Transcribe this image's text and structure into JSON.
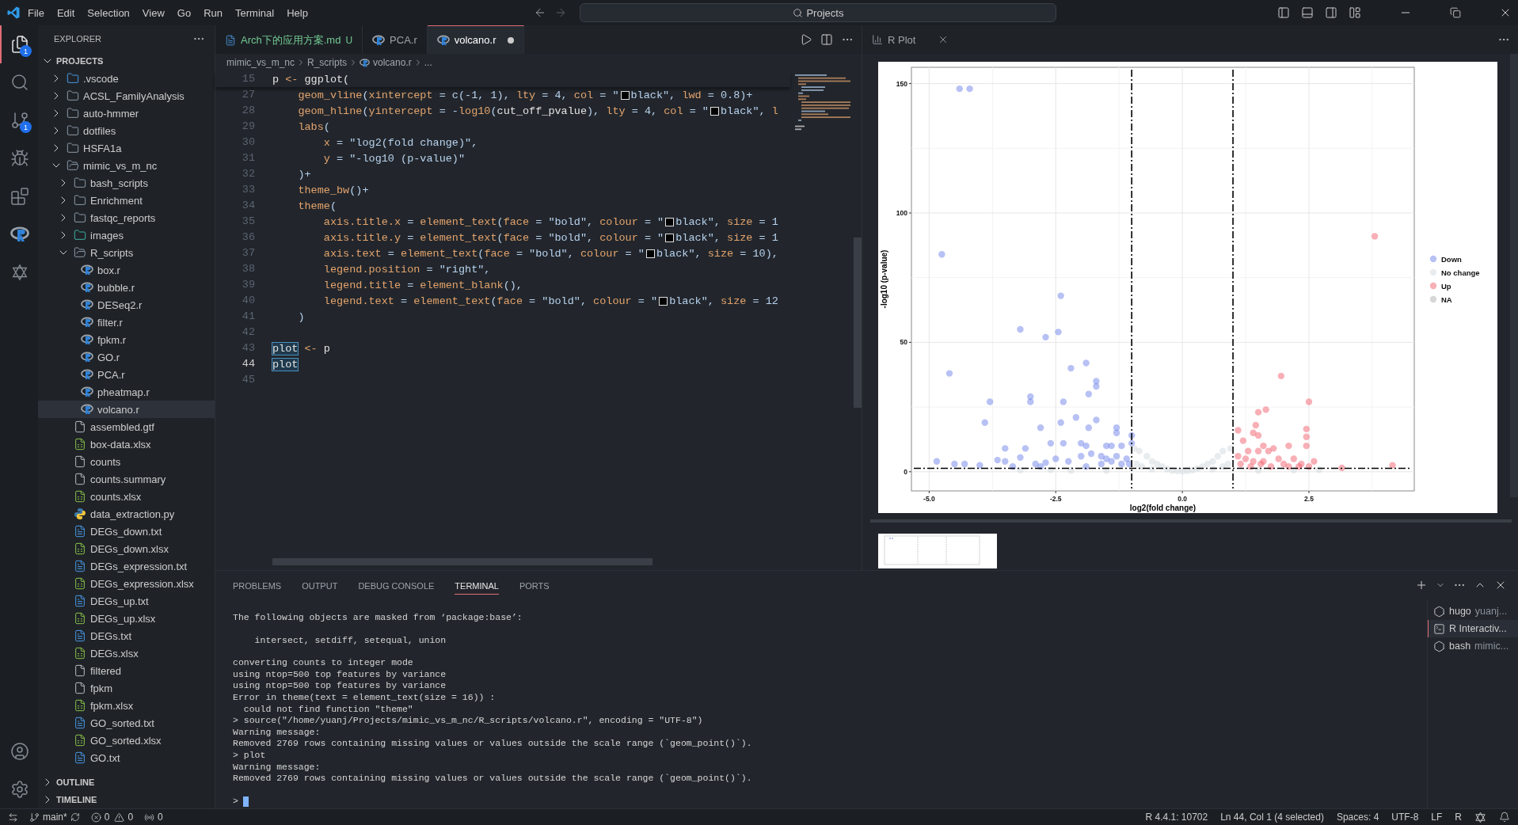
{
  "menu": [
    "File",
    "Edit",
    "Selection",
    "View",
    "Go",
    "Run",
    "Terminal",
    "Help"
  ],
  "command_center": {
    "text": "Projects"
  },
  "activity_bar": {
    "items": [
      {
        "kind": "explorer",
        "badge": "1",
        "selected": true
      },
      {
        "kind": "search",
        "selected": false
      },
      {
        "kind": "source-control",
        "badge": "1",
        "selected": false
      },
      {
        "kind": "run",
        "selected": false
      },
      {
        "kind": "extensions",
        "selected": false
      },
      {
        "kind": "r",
        "selected": false
      },
      {
        "kind": "star",
        "selected": false
      }
    ]
  },
  "sidebar": {
    "title": "EXPLORER",
    "sections": [
      {
        "title": "PROJECTS",
        "expanded": true,
        "items": [
          {
            "label": ".vscode",
            "kind": "vscode-folder",
            "expanded": false,
            "selected": false
          },
          {
            "label": "ACSL_FamilyAnalysis",
            "kind": "folder",
            "expanded": false,
            "selected": false
          },
          {
            "label": "auto-hmmer",
            "kind": "folder",
            "expanded": false,
            "selected": false
          },
          {
            "label": "dotfiles",
            "kind": "folder",
            "expanded": false,
            "selected": false
          },
          {
            "label": "HSFA1a",
            "kind": "folder",
            "expanded": false,
            "selected": false
          },
          {
            "label": "mimic_vs_m_nc",
            "kind": "folder",
            "expanded": true,
            "selected": false,
            "children": [
              {
                "label": "bash_scripts",
                "kind": "folder",
                "expanded": false,
                "selected": false
              },
              {
                "label": "Enrichment",
                "kind": "folder",
                "expanded": false,
                "selected": false
              },
              {
                "label": "fastqc_reports",
                "kind": "folder",
                "expanded": false,
                "selected": false
              },
              {
                "label": "images",
                "kind": "images-folder",
                "expanded": false,
                "selected": false
              },
              {
                "label": "R_scripts",
                "kind": "folder",
                "expanded": true,
                "selected": false,
                "children": [
                  {
                    "label": "box.r",
                    "kind": "r",
                    "selected": false
                  },
                  {
                    "label": "bubble.r",
                    "kind": "r",
                    "selected": false
                  },
                  {
                    "label": "DESeq2.r",
                    "kind": "r",
                    "selected": false
                  },
                  {
                    "label": "filter.r",
                    "kind": "r",
                    "selected": false
                  },
                  {
                    "label": "fpkm.r",
                    "kind": "r",
                    "selected": false
                  },
                  {
                    "label": "GO.r",
                    "kind": "r",
                    "selected": false
                  },
                  {
                    "label": "PCA.r",
                    "kind": "r",
                    "selected": false
                  },
                  {
                    "label": "pheatmap.r",
                    "kind": "r",
                    "selected": false
                  },
                  {
                    "label": "volcano.r",
                    "kind": "r",
                    "selected": true
                  }
                ]
              },
              {
                "label": "assembled.gtf",
                "kind": "file",
                "selected": false
              },
              {
                "label": "box-data.xlsx",
                "kind": "sheet",
                "selected": false
              },
              {
                "label": "counts",
                "kind": "file",
                "selected": false
              },
              {
                "label": "counts.summary",
                "kind": "file",
                "selected": false
              },
              {
                "label": "counts.xlsx",
                "kind": "sheet",
                "selected": false
              },
              {
                "label": "data_extraction.py",
                "kind": "python",
                "selected": false
              },
              {
                "label": "DEGs_down.txt",
                "kind": "text",
                "selected": false
              },
              {
                "label": "DEGs_down.xlsx",
                "kind": "sheet",
                "selected": false
              },
              {
                "label": "DEGs_expression.txt",
                "kind": "text",
                "selected": false
              },
              {
                "label": "DEGs_expression.xlsx",
                "kind": "sheet",
                "selected": false
              },
              {
                "label": "DEGs_up.txt",
                "kind": "text",
                "selected": false
              },
              {
                "label": "DEGs_up.xlsx",
                "kind": "sheet",
                "selected": false
              },
              {
                "label": "DEGs.txt",
                "kind": "text",
                "selected": false
              },
              {
                "label": "DEGs.xlsx",
                "kind": "sheet",
                "selected": false
              },
              {
                "label": "filtered",
                "kind": "file",
                "selected": false
              },
              {
                "label": "fpkm",
                "kind": "file",
                "selected": false
              },
              {
                "label": "fpkm.xlsx",
                "kind": "sheet",
                "selected": false
              },
              {
                "label": "GO_sorted.txt",
                "kind": "text",
                "selected": false
              },
              {
                "label": "GO_sorted.xlsx",
                "kind": "sheet",
                "selected": false
              },
              {
                "label": "GO.txt",
                "kind": "text",
                "selected": false
              }
            ]
          }
        ]
      },
      {
        "title": "OUTLINE",
        "expanded": false
      },
      {
        "title": "TIMELINE",
        "expanded": false
      }
    ]
  },
  "editor": {
    "tabs": [
      {
        "label": "Arch下的应用方案.md",
        "badge": "U",
        "kind": "markdown",
        "selected": false,
        "modified": false
      },
      {
        "label": "PCA.r",
        "kind": "r",
        "selected": false,
        "modified": false
      },
      {
        "label": "volcano.r",
        "kind": "r",
        "selected": true,
        "modified": true
      }
    ],
    "breadcrumbs": [
      {
        "label": "mimic_vs_m_nc",
        "kind": "folder"
      },
      {
        "label": "R_scripts",
        "kind": "folder"
      },
      {
        "label": "volcano.r",
        "kind": "r"
      },
      {
        "label": "...",
        "kind": "more"
      }
    ],
    "sticky_line": {
      "number": "15",
      "tokens": [
        {
          "kind": "plain",
          "text": "p"
        },
        {
          "kind": "key",
          "text": " <- "
        },
        {
          "kind": "plain",
          "text": "ggplot("
        }
      ]
    },
    "lines": [
      {
        "number": "27",
        "current": false,
        "tokens": [
          {
            "kind": "key",
            "text": "    geom_vline"
          },
          {
            "kind": "str",
            "text": "("
          },
          {
            "kind": "key",
            "text": "xintercept"
          },
          {
            "kind": "str",
            "text": " = c(-1, 1), "
          },
          {
            "kind": "key",
            "text": "lty"
          },
          {
            "kind": "str",
            "text": " = 4, "
          },
          {
            "kind": "key",
            "text": "col"
          },
          {
            "kind": "str",
            "text": " = \""
          },
          {
            "kind": "swatch"
          },
          {
            "kind": "str",
            "text": "black\", "
          },
          {
            "kind": "key",
            "text": "lwd"
          },
          {
            "kind": "str",
            "text": " = 0.8)+"
          }
        ]
      },
      {
        "number": "28",
        "current": false,
        "tokens": [
          {
            "kind": "key",
            "text": "    geom_hline"
          },
          {
            "kind": "str",
            "text": "("
          },
          {
            "kind": "key",
            "text": "yintercept"
          },
          {
            "kind": "str",
            "text": " = -"
          },
          {
            "kind": "key",
            "text": "log10"
          },
          {
            "kind": "str",
            "text": "("
          },
          {
            "kind": "plain",
            "text": "cut_off_pvalue"
          },
          {
            "kind": "str",
            "text": "), "
          },
          {
            "kind": "key",
            "text": "lty"
          },
          {
            "kind": "str",
            "text": " = 4, "
          },
          {
            "kind": "key",
            "text": "col"
          },
          {
            "kind": "str",
            "text": " = \""
          },
          {
            "kind": "swatch"
          },
          {
            "kind": "str",
            "text": "black\", "
          },
          {
            "kind": "key",
            "text": "l"
          }
        ]
      },
      {
        "number": "29",
        "current": false,
        "tokens": [
          {
            "kind": "key",
            "text": "    labs"
          },
          {
            "kind": "str",
            "text": "("
          }
        ]
      },
      {
        "number": "30",
        "current": false,
        "tokens": [
          {
            "kind": "key",
            "text": "        x"
          },
          {
            "kind": "str",
            "text": " = \"log2(fold change)\","
          }
        ]
      },
      {
        "number": "31",
        "current": false,
        "tokens": [
          {
            "kind": "key",
            "text": "        y"
          },
          {
            "kind": "str",
            "text": " = \"-log10 (p-value)\""
          }
        ]
      },
      {
        "number": "32",
        "current": false,
        "tokens": [
          {
            "kind": "str",
            "text": "    )+"
          }
        ]
      },
      {
        "number": "33",
        "current": false,
        "tokens": [
          {
            "kind": "key",
            "text": "    theme_bw"
          },
          {
            "kind": "str",
            "text": "()+"
          }
        ]
      },
      {
        "number": "34",
        "current": false,
        "tokens": [
          {
            "kind": "key",
            "text": "    theme"
          },
          {
            "kind": "str",
            "text": "("
          }
        ]
      },
      {
        "number": "35",
        "current": false,
        "tokens": [
          {
            "kind": "key",
            "text": "        axis.title.x"
          },
          {
            "kind": "str",
            "text": " = "
          },
          {
            "kind": "key",
            "text": "element_text"
          },
          {
            "kind": "str",
            "text": "("
          },
          {
            "kind": "key",
            "text": "face"
          },
          {
            "kind": "str",
            "text": " = \"bold\", "
          },
          {
            "kind": "key",
            "text": "colour"
          },
          {
            "kind": "str",
            "text": " = \""
          },
          {
            "kind": "swatch"
          },
          {
            "kind": "str",
            "text": "black\", "
          },
          {
            "kind": "key",
            "text": "size"
          },
          {
            "kind": "str",
            "text": " = 1"
          }
        ]
      },
      {
        "number": "36",
        "current": false,
        "tokens": [
          {
            "kind": "key",
            "text": "        axis.title.y"
          },
          {
            "kind": "str",
            "text": " = "
          },
          {
            "kind": "key",
            "text": "element_text"
          },
          {
            "kind": "str",
            "text": "("
          },
          {
            "kind": "key",
            "text": "face"
          },
          {
            "kind": "str",
            "text": " = \"bold\", "
          },
          {
            "kind": "key",
            "text": "colour"
          },
          {
            "kind": "str",
            "text": " = \""
          },
          {
            "kind": "swatch"
          },
          {
            "kind": "str",
            "text": "black\", "
          },
          {
            "kind": "key",
            "text": "size"
          },
          {
            "kind": "str",
            "text": " = 1"
          }
        ]
      },
      {
        "number": "37",
        "current": false,
        "tokens": [
          {
            "kind": "key",
            "text": "        axis.text"
          },
          {
            "kind": "str",
            "text": " = "
          },
          {
            "kind": "key",
            "text": "element_text"
          },
          {
            "kind": "str",
            "text": "("
          },
          {
            "kind": "key",
            "text": "face"
          },
          {
            "kind": "str",
            "text": " = \"bold\", "
          },
          {
            "kind": "key",
            "text": "colour"
          },
          {
            "kind": "str",
            "text": " = \""
          },
          {
            "kind": "swatch"
          },
          {
            "kind": "str",
            "text": "black\", "
          },
          {
            "kind": "key",
            "text": "size"
          },
          {
            "kind": "str",
            "text": " = 10),"
          }
        ]
      },
      {
        "number": "38",
        "current": false,
        "tokens": [
          {
            "kind": "key",
            "text": "        legend.position"
          },
          {
            "kind": "str",
            "text": " = \"right\","
          }
        ]
      },
      {
        "number": "39",
        "current": false,
        "tokens": [
          {
            "kind": "key",
            "text": "        legend.title"
          },
          {
            "kind": "str",
            "text": " = "
          },
          {
            "kind": "key",
            "text": "element_blank"
          },
          {
            "kind": "str",
            "text": "(),"
          }
        ]
      },
      {
        "number": "40",
        "current": false,
        "tokens": [
          {
            "kind": "key",
            "text": "        legend.text"
          },
          {
            "kind": "str",
            "text": " = "
          },
          {
            "kind": "key",
            "text": "element_text"
          },
          {
            "kind": "str",
            "text": "("
          },
          {
            "kind": "key",
            "text": "face"
          },
          {
            "kind": "str",
            "text": " = \"bold\", "
          },
          {
            "kind": "key",
            "text": "colour"
          },
          {
            "kind": "str",
            "text": " = \""
          },
          {
            "kind": "swatch"
          },
          {
            "kind": "str",
            "text": "black\", "
          },
          {
            "kind": "key",
            "text": "size"
          },
          {
            "kind": "str",
            "text": " = 12"
          }
        ]
      },
      {
        "number": "41",
        "current": false,
        "tokens": [
          {
            "kind": "str",
            "text": "    )"
          }
        ]
      },
      {
        "number": "42",
        "current": false
      },
      {
        "number": "43",
        "current": false,
        "tokens": [
          {
            "kind": "match",
            "text": "plot"
          },
          {
            "kind": "key",
            "text": " <- "
          },
          {
            "kind": "plain",
            "text": "p"
          }
        ]
      },
      {
        "number": "44",
        "current": true,
        "tokens": [
          {
            "kind": "match",
            "text": "plot"
          }
        ]
      },
      {
        "number": "45",
        "current": false
      }
    ]
  },
  "plot_panel": {
    "tab": {
      "label": "R Plot"
    },
    "chart_data": {
      "type": "scatter",
      "xlabel": "log2(fold change)",
      "ylabel": "-log10 (p-value)",
      "xlim": [
        -5.35,
        4.58
      ],
      "ylim": [
        -7.4,
        156.3
      ],
      "xticks": [
        {
          "value": -5,
          "label": "-5.0"
        },
        {
          "value": -2.5,
          "label": "-2.5"
        },
        {
          "value": 0,
          "label": "0.0"
        },
        {
          "value": 2.5,
          "label": "2.5"
        }
      ],
      "yticks": [
        0,
        50,
        100,
        150
      ],
      "ref_lines": [
        {
          "axis": "x",
          "value": -1
        },
        {
          "axis": "x",
          "value": 1
        },
        {
          "axis": "y",
          "value": 1.3
        }
      ],
      "grid": true,
      "legend": true,
      "series": [
        {
          "name": "Down",
          "color": "#6f83ea",
          "x": [
            -4.4,
            -4.2,
            -4.75,
            -4.6,
            -3.8,
            -3.9,
            -3.2,
            -2.4,
            -2.45,
            -2.7,
            -1.9,
            -2.2,
            -1.7,
            -1.7,
            -3.0,
            -3.0,
            -1.85,
            -2.35,
            -2.1,
            -1.7,
            -2.4,
            -2.8,
            -1.85,
            -1.3,
            -1.3,
            -1.0,
            -3.5,
            -3.1,
            -2.6,
            -2.35,
            -2.0,
            -1.9,
            -1.5,
            -1.4,
            -1.2,
            -1.0,
            -4.85,
            -4.5,
            -4.3,
            -4.0,
            -3.65,
            -3.5,
            -3.2,
            -2.9,
            -2.7,
            -2.5,
            -2.25,
            -2.0,
            -1.8,
            -1.6,
            -1.5,
            -1.4,
            -1.3,
            -1.2,
            -1.1,
            -1.05,
            -1.6,
            -3.35,
            -2.8,
            -1.9
          ],
          "values": [
            148,
            148,
            84,
            38,
            27,
            19,
            55,
            68,
            54,
            52,
            42,
            40,
            35,
            33,
            29,
            27,
            30,
            27,
            21,
            20,
            19,
            17,
            17,
            17,
            15,
            14,
            9,
            9,
            11,
            11,
            11,
            10,
            10,
            10,
            10,
            11,
            4,
            3,
            3,
            2.5,
            4.5,
            4,
            5.5,
            3,
            3.5,
            5,
            4,
            6,
            7,
            6,
            5,
            4,
            6,
            3,
            5,
            3,
            3,
            2,
            2,
            2
          ]
        },
        {
          "name": "No change",
          "color": "#d3d9de",
          "x": [
            -0.95,
            -0.85,
            -0.7,
            -0.6,
            -0.5,
            -0.4,
            -0.3,
            -0.2,
            -0.1,
            0,
            0.1,
            0.2,
            0.3,
            0.4,
            0.5,
            0.6,
            0.7,
            0.8,
            0.95,
            -0.9,
            -0.8,
            -0.6,
            0.6,
            0.8,
            0.9,
            -2.6,
            -2.2,
            -1.5,
            1.5,
            2.2,
            2.7,
            -3.2
          ],
          "values": [
            9,
            8,
            6,
            4,
            3,
            2,
            1,
            0.5,
            0.3,
            0.2,
            0.3,
            0.6,
            1.2,
            2,
            3,
            4,
            6,
            8,
            9,
            3,
            2,
            1,
            1,
            2,
            3,
            0.8,
            0.5,
            0.5,
            0.5,
            0.6,
            0.8,
            0.6
          ]
        },
        {
          "name": "Up",
          "color": "#f2606e",
          "x": [
            3.8,
            1.95,
            2.5,
            1.5,
            1.65,
            1.1,
            1.45,
            1.4,
            1.5,
            2.45,
            2.45,
            2.45,
            2.1,
            1.2,
            1.6,
            1.8,
            1.3,
            1.5,
            1.7,
            1.1,
            1.25,
            1.4,
            1.6,
            1.9,
            2.2,
            2.35,
            2.6,
            1.15,
            1.35,
            1.55,
            1.75,
            2.0,
            2.1,
            2.3,
            2.5,
            3.15,
            4.15
          ],
          "values": [
            91,
            37,
            27,
            23,
            24,
            16,
            18,
            15,
            14,
            16.5,
            13.5,
            10,
            10,
            12,
            10,
            9,
            8,
            8,
            8,
            6,
            5,
            4,
            4,
            5,
            5,
            3,
            4,
            3,
            2,
            3,
            2,
            3,
            2,
            2,
            2,
            1.5,
            2.5
          ]
        },
        {
          "name": "NA",
          "color": "#b0b0b0"
        }
      ]
    }
  },
  "panel": {
    "tabs": [
      {
        "label": "PROBLEMS",
        "selected": false
      },
      {
        "label": "OUTPUT",
        "selected": false
      },
      {
        "label": "DEBUG CONSOLE",
        "selected": false
      },
      {
        "label": "TERMINAL",
        "selected": true
      },
      {
        "label": "PORTS",
        "selected": false
      }
    ],
    "terminal": {
      "blocks": [
        [
          "The following objects are masked from ‘package:base’:"
        ],
        [
          "    intersect, setdiff, setequal, union"
        ],
        [
          "converting counts to integer mode",
          "using ntop=500 top features by variance",
          "using ntop=500 top features by variance",
          "Error in theme(text = element_text(size = 16)) :",
          "  could not find function \"theme\"",
          "> source(\"/home/yuanj/Projects/mimic_vs_m_nc/R_scripts/volcano.r\", encoding = \"UTF-8\")",
          "Warning message:",
          "Removed 2769 rows containing missing values or values outside the scale range (`geom_point()`).",
          "> plot",
          "Warning message:",
          "Removed 2769 rows containing missing values or values outside the scale range (`geom_point()`)."
        ]
      ],
      "prompt": ">"
    },
    "sessions": [
      {
        "name": "hugo",
        "detail": "yuanj...",
        "kind": "shell",
        "selected": false
      },
      {
        "name": "R Interactiv...",
        "kind": "terminal",
        "selected": true
      },
      {
        "name": "bash",
        "detail": "mimic...",
        "kind": "shell",
        "selected": false
      }
    ]
  },
  "status_bar": {
    "branch": "main*",
    "indicators": [
      {
        "kind": "errors",
        "count": "0"
      },
      {
        "kind": "warnings",
        "count": "0"
      },
      {
        "kind": "ports",
        "count": "0"
      }
    ],
    "right": [
      "R 4.4.1: 10702",
      "Ln 44, Col 1 (4 selected)",
      "Spaces: 4",
      "UTF-8",
      "LF",
      "R"
    ]
  }
}
